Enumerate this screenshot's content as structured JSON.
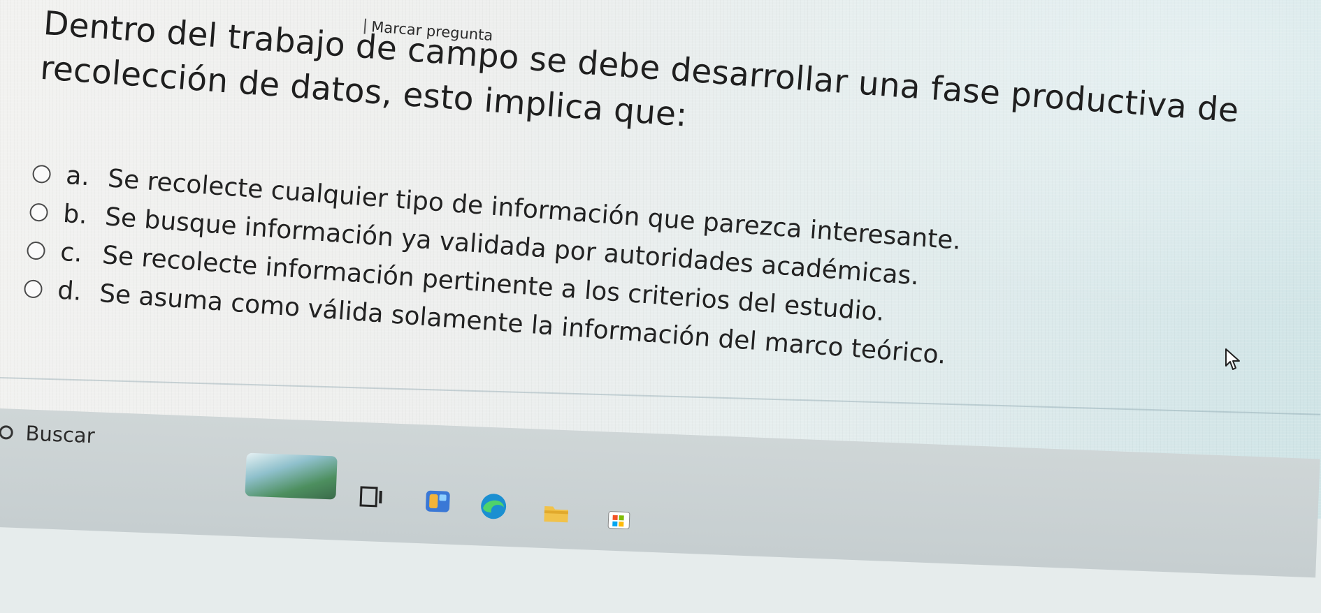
{
  "header": {
    "flag_label": "Marcar pregunta"
  },
  "question": {
    "text": "Dentro del trabajo de campo se debe desarrollar una fase productiva de recolección de datos, esto implica que:"
  },
  "options": [
    {
      "letter": "a.",
      "text": "Se recolecte cualquier tipo de información que parezca interesante."
    },
    {
      "letter": "b.",
      "text": "Se busque información ya validada por autoridades académicas."
    },
    {
      "letter": "c.",
      "text": "Se recolecte información pertinente a los criterios del estudio."
    },
    {
      "letter": "d.",
      "text": "Se asuma como válida solamente la información del marco teórico."
    }
  ],
  "taskbar": {
    "search_label": "Buscar",
    "icons": [
      "task-view-icon",
      "widgets-icon",
      "edge-icon",
      "file-explorer-icon",
      "store-icon"
    ]
  }
}
